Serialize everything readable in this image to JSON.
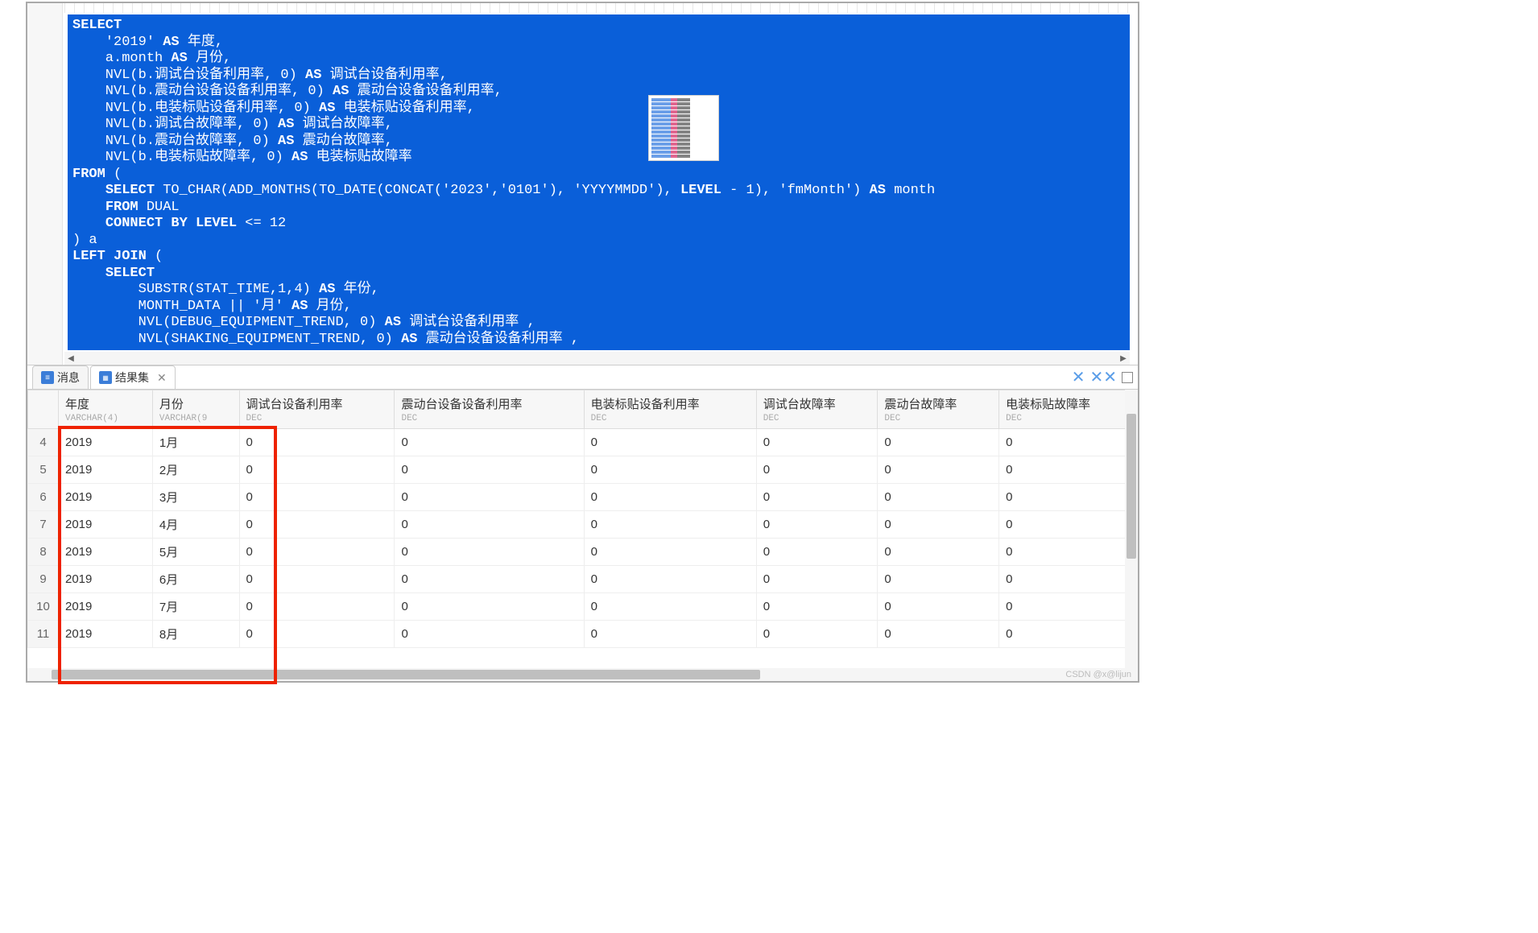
{
  "tabs": {
    "messages": "消息",
    "results": "结果集"
  },
  "sql_tokens": [
    [
      {
        "k": 1,
        "t": "SELECT"
      }
    ],
    [
      {
        "t": "    '2019' "
      },
      {
        "k": 1,
        "t": "AS"
      },
      {
        "t": " 年度,"
      }
    ],
    [
      {
        "t": "    a.month "
      },
      {
        "k": 1,
        "t": "AS"
      },
      {
        "t": " 月份,"
      }
    ],
    [
      {
        "t": "    NVL(b.调试台设备利用率, 0) "
      },
      {
        "k": 1,
        "t": "AS"
      },
      {
        "t": " 调试台设备利用率,"
      }
    ],
    [
      {
        "t": "    NVL(b.震动台设备设备利用率, 0) "
      },
      {
        "k": 1,
        "t": "AS"
      },
      {
        "t": " 震动台设备设备利用率,"
      }
    ],
    [
      {
        "t": "    NVL(b.电装标贴设备利用率, 0) "
      },
      {
        "k": 1,
        "t": "AS"
      },
      {
        "t": " 电装标贴设备利用率,"
      }
    ],
    [
      {
        "t": "    NVL(b.调试台故障率, 0) "
      },
      {
        "k": 1,
        "t": "AS"
      },
      {
        "t": " 调试台故障率,"
      }
    ],
    [
      {
        "t": "    NVL(b.震动台故障率, 0) "
      },
      {
        "k": 1,
        "t": "AS"
      },
      {
        "t": " 震动台故障率,"
      }
    ],
    [
      {
        "t": "    NVL(b.电装标贴故障率, 0) "
      },
      {
        "k": 1,
        "t": "AS"
      },
      {
        "t": " 电装标贴故障率"
      }
    ],
    [
      {
        "k": 1,
        "t": "FROM"
      },
      {
        "t": " ("
      }
    ],
    [
      {
        "t": "    "
      },
      {
        "k": 1,
        "t": "SELECT"
      },
      {
        "t": " TO_CHAR(ADD_MONTHS(TO_DATE(CONCAT('2023','0101'), 'YYYYMMDD'), "
      },
      {
        "k": 1,
        "t": "LEVEL"
      },
      {
        "t": " - 1), 'fmMonth') "
      },
      {
        "k": 1,
        "t": "AS"
      },
      {
        "t": " month"
      }
    ],
    [
      {
        "t": "    "
      },
      {
        "k": 1,
        "t": "FROM"
      },
      {
        "t": " DUAL"
      }
    ],
    [
      {
        "t": "    "
      },
      {
        "k": 1,
        "t": "CONNECT BY LEVEL"
      },
      {
        "t": " <= 12"
      }
    ],
    [
      {
        "t": ") a"
      }
    ],
    [
      {
        "k": 1,
        "t": "LEFT JOIN"
      },
      {
        "t": " ("
      }
    ],
    [
      {
        "t": "    "
      },
      {
        "k": 1,
        "t": "SELECT"
      }
    ],
    [
      {
        "t": "        SUBSTR(STAT_TIME,1,4) "
      },
      {
        "k": 1,
        "t": "AS"
      },
      {
        "t": " 年份,"
      }
    ],
    [
      {
        "t": "        MONTH_DATA || '月' "
      },
      {
        "k": 1,
        "t": "AS"
      },
      {
        "t": " 月份,"
      }
    ],
    [
      {
        "t": "        NVL(DEBUG_EQUIPMENT_TREND, 0) "
      },
      {
        "k": 1,
        "t": "AS"
      },
      {
        "t": " 调试台设备利用率 ,"
      }
    ],
    [
      {
        "t": "        NVL(SHAKING_EQUIPMENT_TREND, 0) "
      },
      {
        "k": 1,
        "t": "AS"
      },
      {
        "t": " 震动台设备设备利用率 ,"
      }
    ]
  ],
  "columns": [
    {
      "name": "",
      "type": ""
    },
    {
      "name": "年度",
      "type": "VARCHAR(4)"
    },
    {
      "name": "月份",
      "type": "VARCHAR(9"
    },
    {
      "name": "调试台设备利用率",
      "type": "DEC"
    },
    {
      "name": "震动台设备设备利用率",
      "type": "DEC"
    },
    {
      "name": "电装标贴设备利用率",
      "type": "DEC"
    },
    {
      "name": "调试台故障率",
      "type": "DEC"
    },
    {
      "name": "震动台故障率",
      "type": "DEC"
    },
    {
      "name": "电装标贴故障率",
      "type": "DEC"
    }
  ],
  "rows": [
    {
      "n": "4",
      "year": "2019",
      "month": "1月",
      "v": [
        "0",
        "0",
        "0",
        "0",
        "0",
        "0"
      ]
    },
    {
      "n": "5",
      "year": "2019",
      "month": "2月",
      "v": [
        "0",
        "0",
        "0",
        "0",
        "0",
        "0"
      ]
    },
    {
      "n": "6",
      "year": "2019",
      "month": "3月",
      "v": [
        "0",
        "0",
        "0",
        "0",
        "0",
        "0"
      ]
    },
    {
      "n": "7",
      "year": "2019",
      "month": "4月",
      "v": [
        "0",
        "0",
        "0",
        "0",
        "0",
        "0"
      ]
    },
    {
      "n": "8",
      "year": "2019",
      "month": "5月",
      "v": [
        "0",
        "0",
        "0",
        "0",
        "0",
        "0"
      ]
    },
    {
      "n": "9",
      "year": "2019",
      "month": "6月",
      "v": [
        "0",
        "0",
        "0",
        "0",
        "0",
        "0"
      ]
    },
    {
      "n": "10",
      "year": "2019",
      "month": "7月",
      "v": [
        "0",
        "0",
        "0",
        "0",
        "0",
        "0"
      ]
    },
    {
      "n": "11",
      "year": "2019",
      "month": "8月",
      "v": [
        "0",
        "0",
        "0",
        "0",
        "0",
        "0"
      ]
    }
  ],
  "watermark": "CSDN @x@lijun"
}
